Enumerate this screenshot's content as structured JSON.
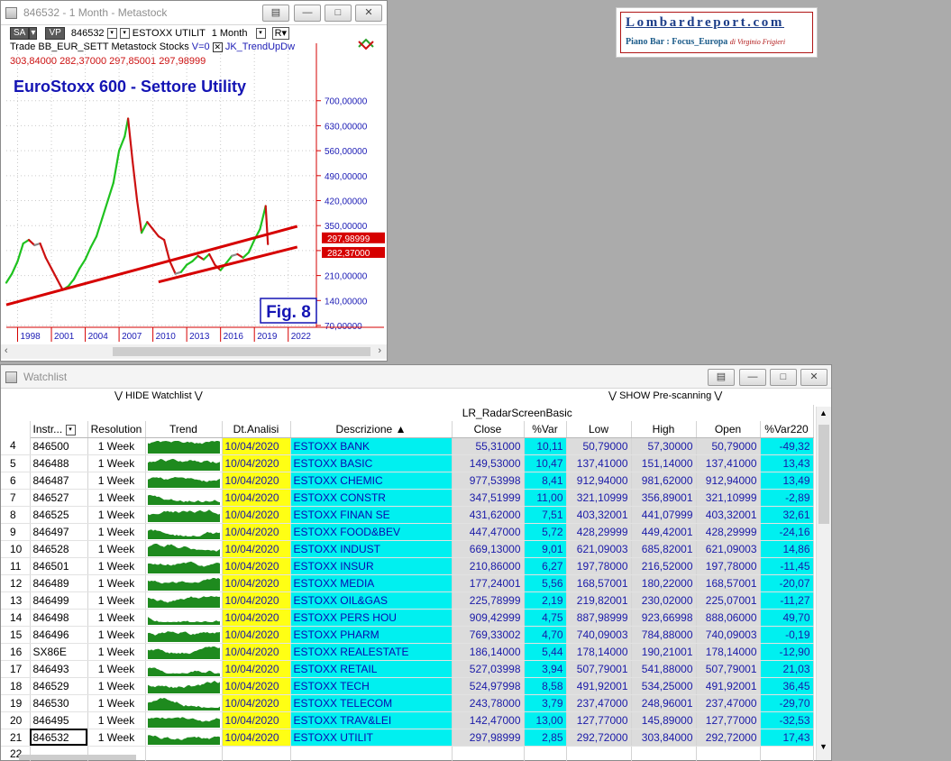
{
  "chart_window": {
    "title": "846532 - 1 Month - Metastock",
    "toolbar": {
      "sa": "SA",
      "vp": "VP",
      "symbol": "846532",
      "name": "ESTOXX UTILIT",
      "timeframe": "1 Month",
      "r": "R",
      "row2": [
        "Trade",
        "BB_EUR_SETT",
        "Metastock",
        "Stocks",
        "V=0",
        "JK_TrendUpDw"
      ],
      "ohlc": [
        "303,84000",
        "282,37000",
        "297,85001",
        "297,98999"
      ]
    },
    "fig_label": "Fig.  8"
  },
  "chart_data": {
    "type": "line",
    "title": "EuroStoxx 600 - Settore Utility",
    "x_ticks": [
      "1998",
      "2001",
      "2004",
      "2007",
      "2010",
      "2013",
      "2016",
      "2019",
      "2022"
    ],
    "y_ticks": [
      "700,00000",
      "630,00000",
      "560,00000",
      "490,00000",
      "420,00000",
      "350,00000",
      "280,00000",
      "210,00000",
      "140,00000",
      "70,00000"
    ],
    "ylim": [
      70,
      760
    ],
    "xlim": [
      1997.0,
      2024.5
    ],
    "price_labels": [
      "297,98999",
      "282,37000"
    ],
    "series": [
      {
        "values_x": [
          1997.0,
          1997.5,
          1998.0,
          1998.5,
          1999.0,
          1999.5,
          2000.0,
          2000.5,
          2001.0,
          2001.5,
          2002.0,
          2002.5,
          2003.0,
          2003.5,
          2004.0,
          2004.5,
          2005.0,
          2005.5,
          2006.0,
          2006.5,
          2007.0,
          2007.5,
          2007.8,
          2008.2,
          2008.6,
          2009.0,
          2009.5,
          2010.0,
          2010.5,
          2011.0,
          2011.5,
          2012.0,
          2012.5,
          2013.0,
          2013.5,
          2014.0,
          2014.5,
          2015.0,
          2015.5,
          2016.0,
          2016.5,
          2017.0,
          2017.5,
          2018.0,
          2018.5,
          2019.0,
          2019.5,
          2020.0,
          2020.2
        ],
        "values_y": [
          190,
          215,
          250,
          300,
          310,
          295,
          300,
          260,
          230,
          200,
          170,
          180,
          200,
          230,
          255,
          290,
          320,
          370,
          420,
          470,
          560,
          600,
          650,
          530,
          420,
          330,
          360,
          340,
          320,
          310,
          250,
          215,
          220,
          240,
          250,
          265,
          255,
          270,
          240,
          225,
          245,
          265,
          270,
          260,
          275,
          310,
          340,
          405,
          298
        ]
      }
    ],
    "trendlines": [
      {
        "x": [
          1997.0,
          2022.8
        ],
        "y": [
          128,
          348
        ]
      },
      {
        "x": [
          2010.5,
          2022.8
        ],
        "y": [
          192,
          290
        ]
      }
    ],
    "colors": {
      "up": "#1fc21f",
      "down": "#cc1111",
      "flat": "#8a8a8a",
      "trend": "#d60000",
      "axis": "#d60000",
      "tick_text": "#1b1bb5"
    }
  },
  "logo": {
    "title": "Lombardreport.com",
    "subtitle": "Piano Bar : Focus_Europa",
    "author": "di Virginio Frigieri"
  },
  "watchlist_window": {
    "title": "Watchlist",
    "hide_label": "HIDE Watchlist",
    "show_label": "SHOW Pre-scanning",
    "scan_name": "LR_RadarScreenBasic",
    "left_headers": [
      "Instr...",
      "Resolution",
      "Trend"
    ],
    "right_headers": [
      "Dt.Analisi",
      "Descrizione",
      "Close",
      "%Var",
      "Low",
      "High",
      "Open",
      "%Var220"
    ],
    "rows": [
      {
        "n": "4",
        "instr": "846500",
        "res": "1 Week",
        "date": "10/04/2020",
        "desc": "ESTOXX BANK",
        "close": "55,31000",
        "var": "10,11",
        "low": "50,79000",
        "high": "57,30000",
        "open": "50,79000",
        "var220": "-49,32"
      },
      {
        "n": "5",
        "instr": "846488",
        "res": "1 Week",
        "date": "10/04/2020",
        "desc": "ESTOXX BASIC",
        "close": "149,53000",
        "var": "10,47",
        "low": "137,41000",
        "high": "151,14000",
        "open": "137,41000",
        "var220": "13,43"
      },
      {
        "n": "6",
        "instr": "846487",
        "res": "1 Week",
        "date": "10/04/2020",
        "desc": "ESTOXX CHEMIC",
        "close": "977,53998",
        "var": "8,41",
        "low": "912,94000",
        "high": "981,62000",
        "open": "912,94000",
        "var220": "13,49"
      },
      {
        "n": "7",
        "instr": "846527",
        "res": "1 Week",
        "date": "10/04/2020",
        "desc": "ESTOXX CONSTR",
        "close": "347,51999",
        "var": "11,00",
        "low": "321,10999",
        "high": "356,89001",
        "open": "321,10999",
        "var220": "-2,89"
      },
      {
        "n": "8",
        "instr": "846525",
        "res": "1 Week",
        "date": "10/04/2020",
        "desc": "ESTOXX FINAN SE",
        "close": "431,62000",
        "var": "7,51",
        "low": "403,32001",
        "high": "441,07999",
        "open": "403,32001",
        "var220": "32,61"
      },
      {
        "n": "9",
        "instr": "846497",
        "res": "1 Week",
        "date": "10/04/2020",
        "desc": "ESTOXX FOOD&BEV",
        "close": "447,47000",
        "var": "5,72",
        "low": "428,29999",
        "high": "449,42001",
        "open": "428,29999",
        "var220": "-24,16"
      },
      {
        "n": "10",
        "instr": "846528",
        "res": "1 Week",
        "date": "10/04/2020",
        "desc": "ESTOXX INDUST",
        "close": "669,13000",
        "var": "9,01",
        "low": "621,09003",
        "high": "685,82001",
        "open": "621,09003",
        "var220": "14,86"
      },
      {
        "n": "11",
        "instr": "846501",
        "res": "1 Week",
        "date": "10/04/2020",
        "desc": "ESTOXX INSUR",
        "close": "210,86000",
        "var": "6,27",
        "low": "197,78000",
        "high": "216,52000",
        "open": "197,78000",
        "var220": "-11,45"
      },
      {
        "n": "12",
        "instr": "846489",
        "res": "1 Week",
        "date": "10/04/2020",
        "desc": "ESTOXX MEDIA",
        "close": "177,24001",
        "var": "5,56",
        "low": "168,57001",
        "high": "180,22000",
        "open": "168,57001",
        "var220": "-20,07"
      },
      {
        "n": "13",
        "instr": "846499",
        "res": "1 Week",
        "date": "10/04/2020",
        "desc": "ESTOXX OIL&GAS",
        "close": "225,78999",
        "var": "2,19",
        "low": "219,82001",
        "high": "230,02000",
        "open": "225,07001",
        "var220": "-11,27"
      },
      {
        "n": "14",
        "instr": "846498",
        "res": "1 Week",
        "date": "10/04/2020",
        "desc": "ESTOXX PERS HOU",
        "close": "909,42999",
        "var": "4,75",
        "low": "887,98999",
        "high": "923,66998",
        "open": "888,06000",
        "var220": "49,70"
      },
      {
        "n": "15",
        "instr": "846496",
        "res": "1 Week",
        "date": "10/04/2020",
        "desc": "ESTOXX PHARM",
        "close": "769,33002",
        "var": "4,70",
        "low": "740,09003",
        "high": "784,88000",
        "open": "740,09003",
        "var220": "-0,19"
      },
      {
        "n": "16",
        "instr": "SX86E",
        "res": "1 Week",
        "date": "10/04/2020",
        "desc": "ESTOXX REALESTATE",
        "close": "186,14000",
        "var": "5,44",
        "low": "178,14000",
        "high": "190,21001",
        "open": "178,14000",
        "var220": "-12,90"
      },
      {
        "n": "17",
        "instr": "846493",
        "res": "1 Week",
        "date": "10/04/2020",
        "desc": "ESTOXX RETAIL",
        "close": "527,03998",
        "var": "3,94",
        "low": "507,79001",
        "high": "541,88000",
        "open": "507,79001",
        "var220": "21,03"
      },
      {
        "n": "18",
        "instr": "846529",
        "res": "1 Week",
        "date": "10/04/2020",
        "desc": "ESTOXX TECH",
        "close": "524,97998",
        "var": "8,58",
        "low": "491,92001",
        "high": "534,25000",
        "open": "491,92001",
        "var220": "36,45"
      },
      {
        "n": "19",
        "instr": "846530",
        "res": "1 Week",
        "date": "10/04/2020",
        "desc": "ESTOXX TELECOM",
        "close": "243,78000",
        "var": "3,79",
        "low": "237,47000",
        "high": "248,96001",
        "open": "237,47000",
        "var220": "-29,70"
      },
      {
        "n": "20",
        "instr": "846495",
        "res": "1 Week",
        "date": "10/04/2020",
        "desc": "ESTOXX TRAV&LEI",
        "close": "142,47000",
        "var": "13,00",
        "low": "127,77000",
        "high": "145,89000",
        "open": "127,77000",
        "var220": "-32,53"
      },
      {
        "n": "21",
        "instr": "846532",
        "res": "1 Week",
        "date": "10/04/2020",
        "desc": "ESTOXX UTILIT",
        "close": "297,98999",
        "var": "2,85",
        "low": "292,72000",
        "high": "303,84000",
        "open": "292,72000",
        "var220": "17,43"
      }
    ],
    "empty_rows": [
      "22"
    ]
  }
}
